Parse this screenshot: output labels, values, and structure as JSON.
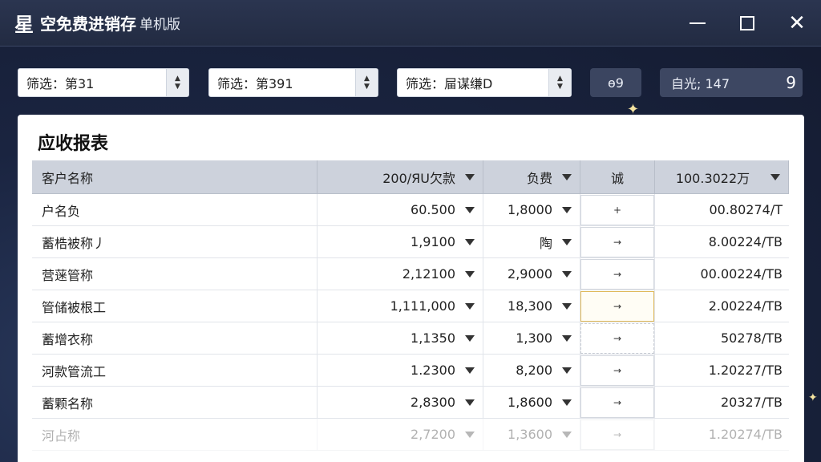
{
  "titlebar": {
    "logo": "星",
    "title": "空免费进销存",
    "subtitle": "单机版",
    "minimize_icon": "minimize-icon",
    "maximize_icon": "maximize-icon",
    "close_icon": "close-icon",
    "close_glyph": "✕"
  },
  "filters": [
    {
      "label": "筛选：第31"
    },
    {
      "label": "筛选：第391"
    },
    {
      "label": "筛选：屇谋缣D"
    }
  ],
  "spinner": {
    "up": "▲",
    "down": "▼"
  },
  "pill_button": {
    "label": "ө9"
  },
  "search_pill": {
    "label": "自光; 147",
    "value": "9"
  },
  "report": {
    "title": "应收报表",
    "columns": [
      "客户名称",
      "200/ЯU欠款",
      "负费",
      "诚",
      "100.3022万"
    ],
    "rows": [
      {
        "name": "户名负",
        "amount": "60.500",
        "fee": "1,8000",
        "action": "+",
        "total": "00.80274/T",
        "state": "normal"
      },
      {
        "name": "蓄梏被称丿",
        "amount": "1,9100",
        "fee": "陶",
        "action": "→",
        "total": "8.00224/TB",
        "state": "normal"
      },
      {
        "name": "营蒾管称",
        "amount": "2,12100",
        "fee": "2,9000",
        "action": "→",
        "total": "00.00224/TB",
        "state": "normal"
      },
      {
        "name": "管储被根工",
        "amount": "1,111,000",
        "fee": "18,300",
        "action": "→",
        "total": "2.00224/TB",
        "state": "selected"
      },
      {
        "name": "蓄增衣称",
        "amount": "1,1350",
        "fee": "1,300",
        "action": "→",
        "total": "50278/TB",
        "state": "dashed"
      },
      {
        "name": "河款管流工",
        "amount": "1.2300",
        "fee": "8,200",
        "action": "→",
        "total": "1.20227/TB",
        "state": "normal"
      },
      {
        "name": "蓄颗名称",
        "amount": "2,8300",
        "fee": "1,8600",
        "action": "→",
        "total": "20327/TB",
        "state": "normal"
      },
      {
        "name": "河占称",
        "amount": "2,7200",
        "fee": "1,3600",
        "action": "→",
        "total": "1.20274/TB",
        "state": "faded"
      }
    ]
  },
  "colors": {
    "titlebar_bg": "#2b3550",
    "panel_bg": "#ffffff",
    "header_bg": "#cdd2dc",
    "selected_border": "#e0b95a"
  }
}
